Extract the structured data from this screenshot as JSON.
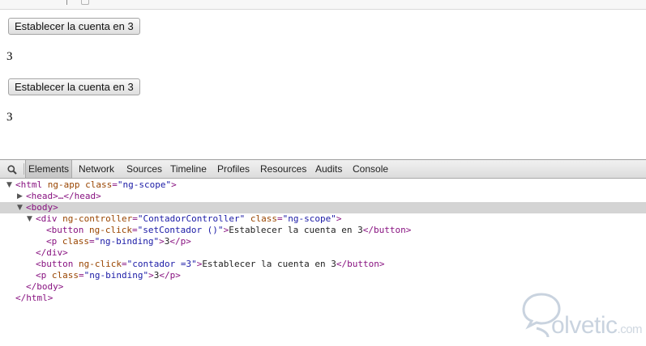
{
  "page": {
    "button_1_label": "Establecer la cuenta en 3",
    "count_1": "3",
    "button_2_label": "Establecer la cuenta en 3",
    "count_2": "3"
  },
  "devtools": {
    "tabs": [
      {
        "label": "Elements",
        "active": true
      },
      {
        "label": "Network"
      },
      {
        "label": "Sources"
      },
      {
        "label": "Timeline"
      },
      {
        "label": "Profiles"
      },
      {
        "label": "Resources"
      },
      {
        "label": "Audits"
      },
      {
        "label": "Console"
      }
    ],
    "tree": {
      "line1": {
        "open": "<html",
        "a1": "ng-app",
        "a2": "class",
        "eq": "=",
        "v2": "\"ng-scope\"",
        "close": ">"
      },
      "line2": {
        "text": "<head>…</head>"
      },
      "line3": {
        "text": "<body>"
      },
      "line4": {
        "open": "<div",
        "a1": "ng-controller",
        "v1": "\"ContadorController\"",
        "a2": "class",
        "v2": "\"ng-scope\"",
        "close": ">"
      },
      "line5": {
        "open": "<button",
        "a1": "ng-click",
        "v1": "\"setContador ()\"",
        "close": ">",
        "text": "Establecer la cuenta en 3",
        "end": "</button>"
      },
      "line6": {
        "open": "<p",
        "a1": "class",
        "v1": "\"ng-binding\"",
        "close": ">",
        "text": "3",
        "end": "</p>"
      },
      "line7": {
        "text": "</div>"
      },
      "line8": {
        "open": "<button",
        "a1": "ng-click",
        "v1": "\"contador =3\"",
        "close": ">",
        "text": "Establecer la cuenta en 3",
        "end": "</button>"
      },
      "line9": {
        "open": "<p",
        "a1": "class",
        "v1": "\"ng-binding\"",
        "close": ">",
        "text": "3",
        "end": "</p>"
      },
      "line10": {
        "text": "</body>"
      },
      "line11": {
        "text": "</html>"
      }
    }
  },
  "watermark": {
    "brand": "olvetic",
    "domain": ".com"
  },
  "colors": {
    "tag": "#881280",
    "attribute": "#994500",
    "value": "#1a1aa6",
    "selected_row": "#d4d4d4"
  }
}
